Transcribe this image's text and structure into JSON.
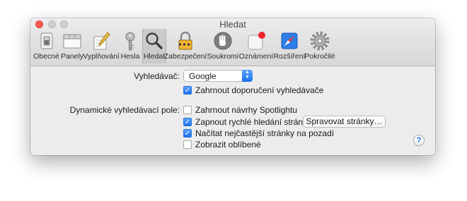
{
  "window": {
    "title": "Hledat"
  },
  "toolbar": {
    "items": [
      {
        "label": "Obecné",
        "icon": "general-switch-icon",
        "selected": false
      },
      {
        "label": "Panely",
        "icon": "tabs-icon",
        "selected": false
      },
      {
        "label": "Vyplňování",
        "icon": "autofill-pencil-icon",
        "selected": false
      },
      {
        "label": "Hesla",
        "icon": "key-icon",
        "selected": false
      },
      {
        "label": "Hledat",
        "icon": "magnifier-icon",
        "selected": true
      },
      {
        "label": "Zabezpečení",
        "icon": "padlock-icon",
        "selected": false
      },
      {
        "label": "Soukromí",
        "icon": "privacy-hand-icon",
        "selected": false
      },
      {
        "label": "Oznámení",
        "icon": "notifications-badge-icon",
        "selected": false
      },
      {
        "label": "Rozšíření",
        "icon": "extensions-compass-icon",
        "selected": false
      },
      {
        "label": "Pokročilé",
        "icon": "advanced-gear-icon",
        "selected": false
      }
    ]
  },
  "search": {
    "engine_label": "Vyhledávač:",
    "engine_value": "Google",
    "suggestions_label": "Zahrnout doporučení vyhledávače",
    "suggestions_checked": true
  },
  "smart_search": {
    "label": "Dynamické vyhledávací pole:",
    "options": [
      {
        "label": "Zahrnout návrhy Spotlightu",
        "checked": false
      },
      {
        "label": "Zapnout rychlé hledání stránek",
        "checked": true
      },
      {
        "label": "Načítat nejčastější stránky na pozadí",
        "checked": true
      },
      {
        "label": "Zobrazit oblíbené",
        "checked": false
      }
    ],
    "manage_button": "Spravovat stránky…"
  },
  "help": {
    "glyph": "?"
  },
  "colors": {
    "accent": "#1b6ff0",
    "close": "#fc5a55"
  }
}
